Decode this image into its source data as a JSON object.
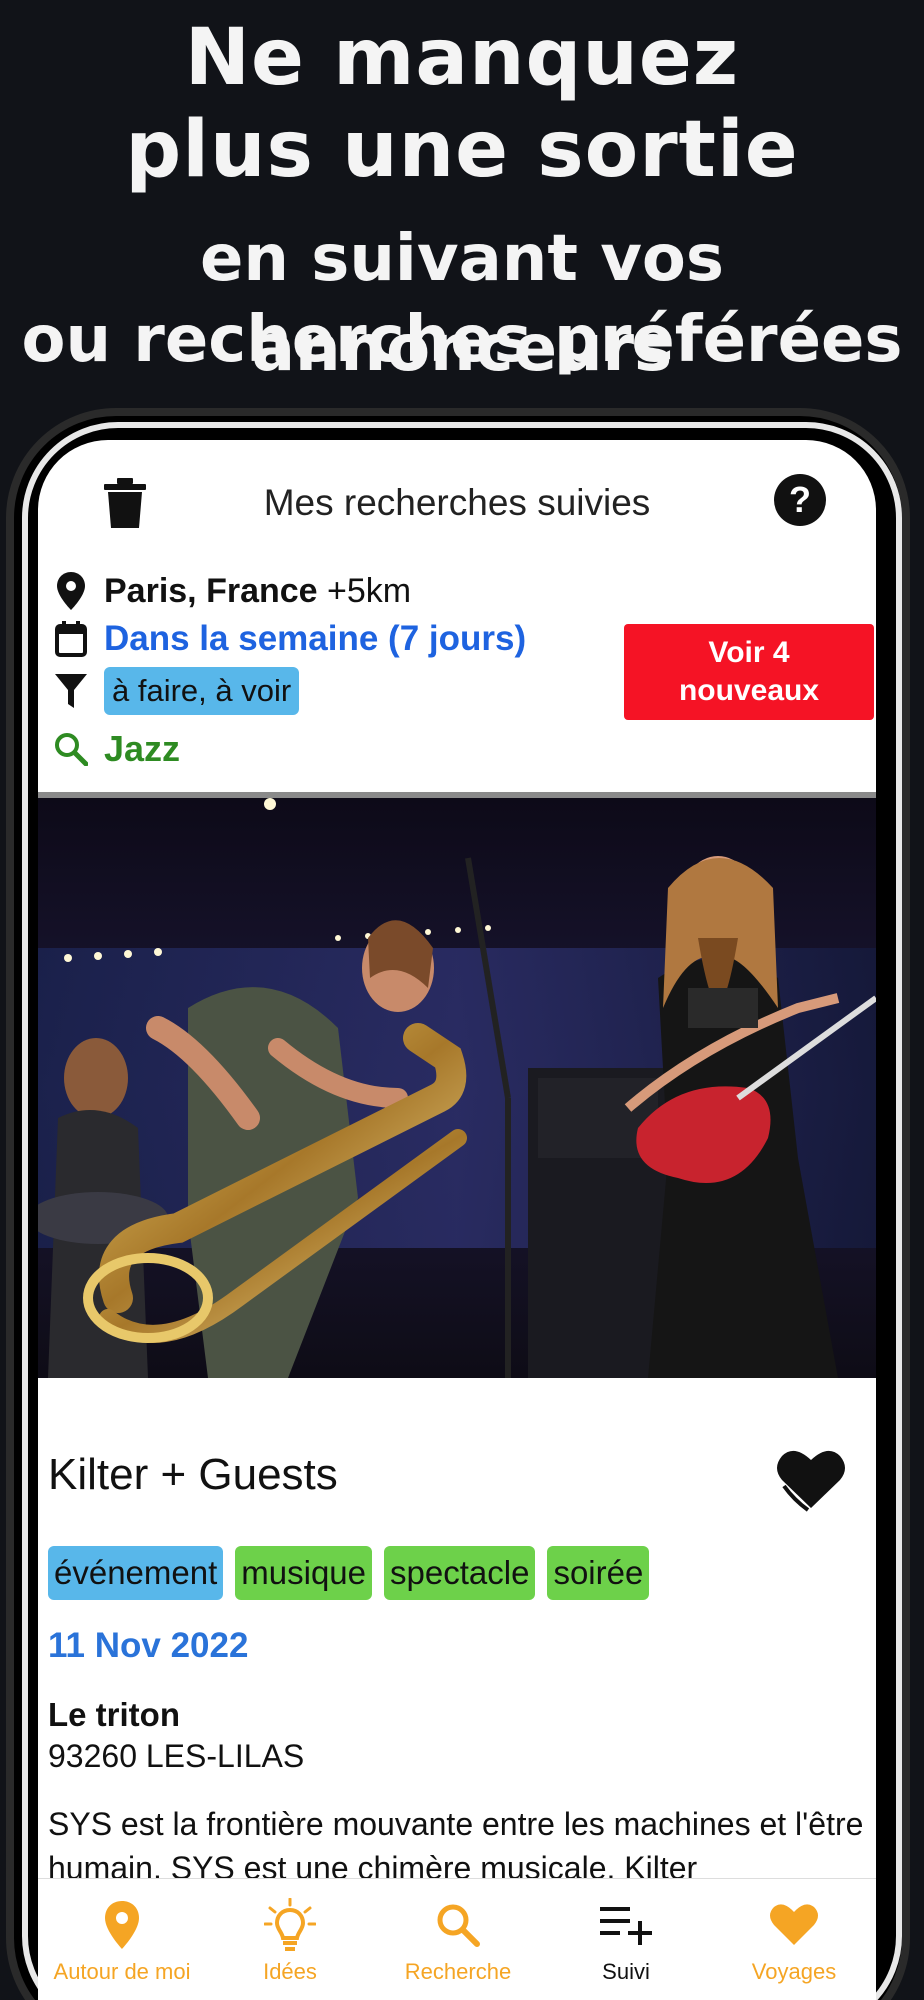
{
  "promo": {
    "line1": "Ne manquez",
    "line2": "plus une sortie",
    "line3": "en suivant vos annonceurs",
    "line4": "ou recherches préférées"
  },
  "header": {
    "title": "Mes recherches suivies",
    "help_label": "?"
  },
  "filters": {
    "location_bold": "Paris, France",
    "location_radius": " +5km",
    "date": "Dans la semaine (7 jours)",
    "category": "à faire, à voir",
    "keyword": "Jazz"
  },
  "new_button": {
    "line1": "Voir 4",
    "line2": "nouveaux"
  },
  "event": {
    "title": "Kilter + Guests",
    "tags": [
      "événement",
      "musique",
      "spectacle",
      "soirée"
    ],
    "date": "11 Nov 2022",
    "venue": "Le triton",
    "address": "93260 LES-LILAS",
    "description": "SYS est la frontière mouvante entre les machines et l'être humain. SYS est une chimère musicale. Kilter"
  },
  "tabs": [
    {
      "label": "Autour de moi",
      "icon": "location-pin-icon"
    },
    {
      "label": "Idées",
      "icon": "lightbulb-icon"
    },
    {
      "label": "Recherche",
      "icon": "search-icon"
    },
    {
      "label": "Suivi",
      "icon": "playlist-add-icon"
    },
    {
      "label": "Voyages",
      "icon": "heart-icon"
    }
  ],
  "colors": {
    "background": "#111318",
    "accent_orange": "#f5a524",
    "alert_red": "#f51325",
    "link_blue": "#1e63e0",
    "keyword_green": "#2e8b22",
    "tag_blue": "#58b7ea",
    "tag_green": "#6dd14a"
  }
}
